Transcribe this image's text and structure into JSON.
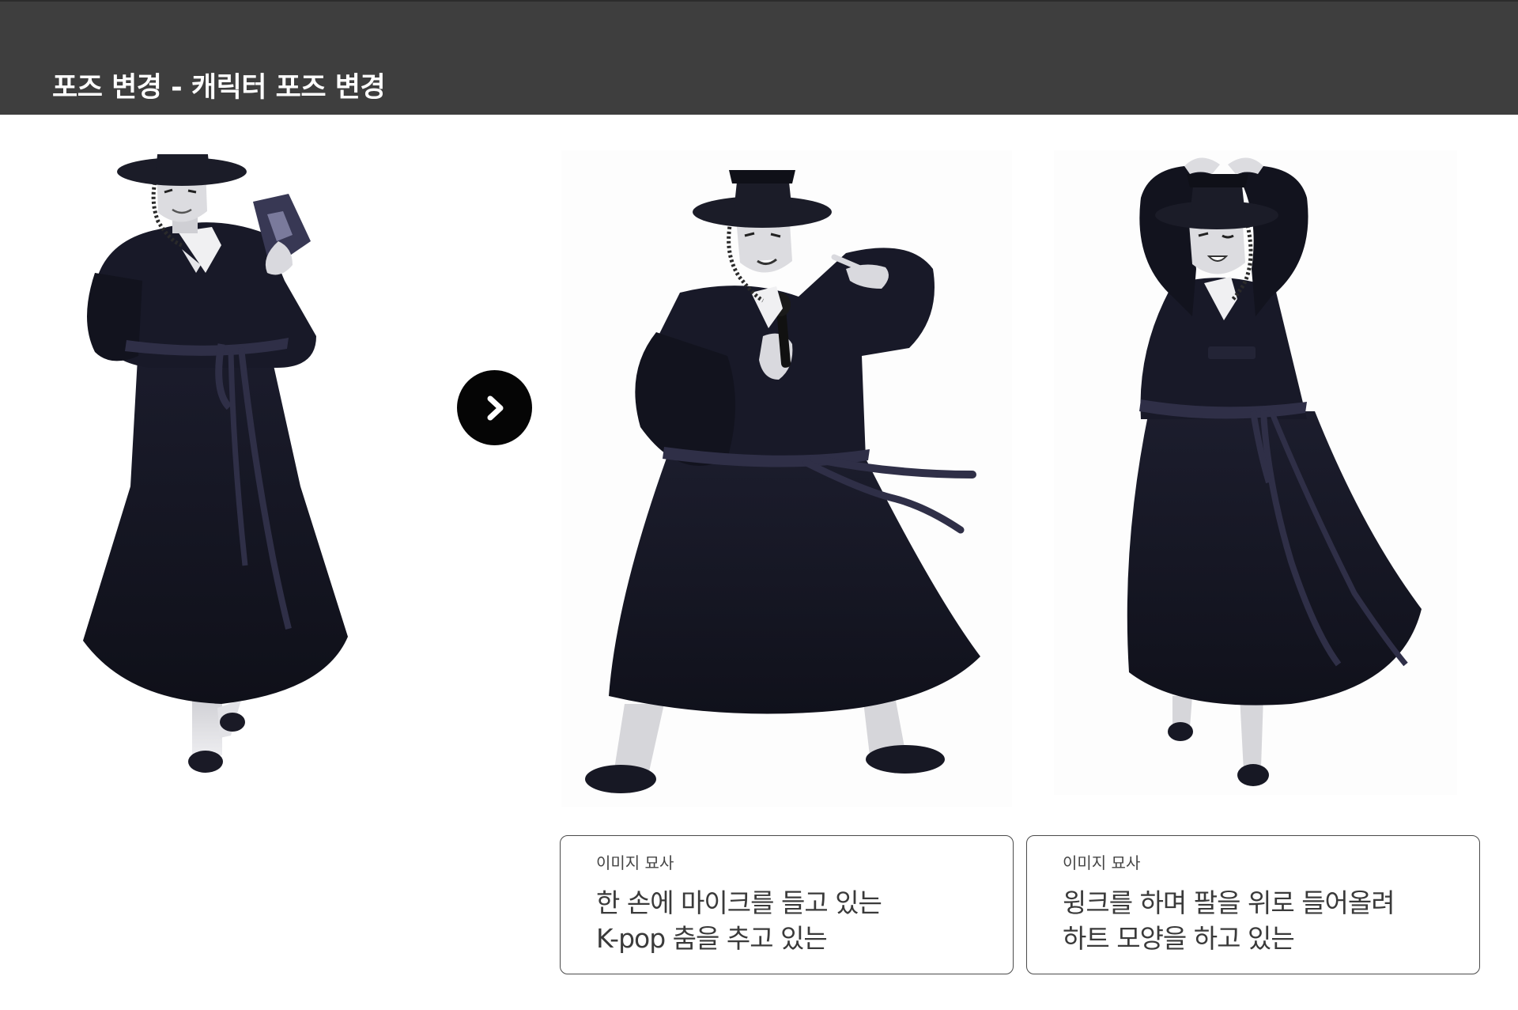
{
  "header": {
    "title": "포즈 변경 - 캐릭터 포즈 변경"
  },
  "colors": {
    "header_bg": "#3e3e3e",
    "robe": "#141523",
    "belt": "#2f2f47",
    "skin": "#d9d9de",
    "button_bg": "#050505"
  },
  "navigation": {
    "next_icon": "chevron-right-icon"
  },
  "cards": [
    {
      "label": "이미지 묘사",
      "lines": [
        "한 손에 마이크를 들고 있는",
        "K-pop 춤을 추고 있는"
      ]
    },
    {
      "label": "이미지 묘사",
      "lines": [
        "윙크를 하며 팔을 위로 들어올려",
        "하트 모양을 하고 있는"
      ]
    }
  ]
}
